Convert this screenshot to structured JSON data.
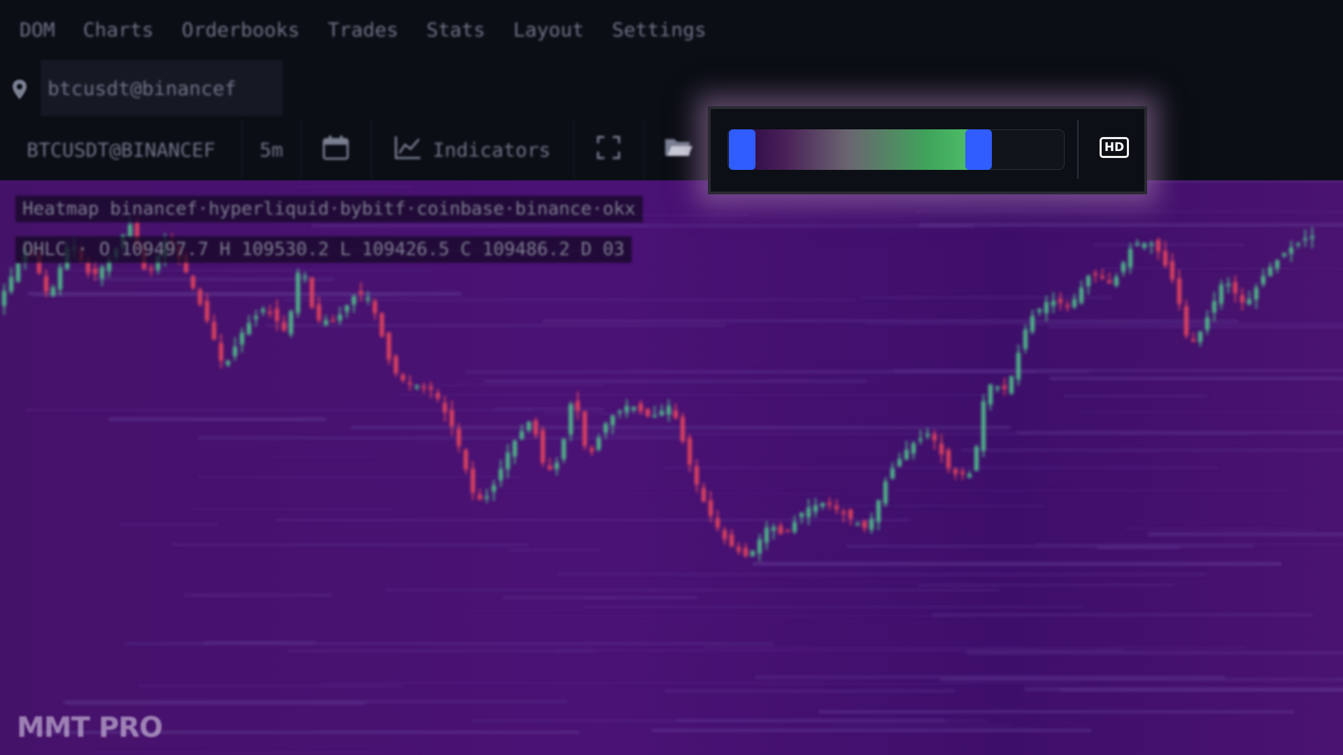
{
  "menu": {
    "items": [
      "DOM",
      "Charts",
      "Orderbooks",
      "Trades",
      "Stats",
      "Layout",
      "Settings"
    ]
  },
  "symbol_search": {
    "value": "btcusdt@binancef"
  },
  "toolbar": {
    "symbol": "BTCUSDT@BINANCEF",
    "timeframe": "5m",
    "indicators_label": "Indicators"
  },
  "heatmap_slider": {
    "low": 0.0,
    "high": 0.85,
    "hd_label": "HD",
    "handle_color": "#2f5dff"
  },
  "legend": {
    "heatmap": "Heatmap binancef·hyperliquid·bybitf·coinbase·binance·okx",
    "ohlc": "OHLC · O 109497.7 H 109530.2 L 109426.5 C 109486.2 D 03"
  },
  "watermark": "MMT PRO",
  "colors": {
    "background": "#0b0e15",
    "heatmap_base": "#48116a",
    "up": "#4fb88a",
    "down": "#e0435f",
    "level_line": "#b9b46e"
  },
  "icons": {
    "symbol": "pin-icon",
    "calendar": "calendar-icon",
    "indicators": "chart-line-icon",
    "fullscreen": "fullscreen-icon",
    "open": "folder-icon"
  }
}
